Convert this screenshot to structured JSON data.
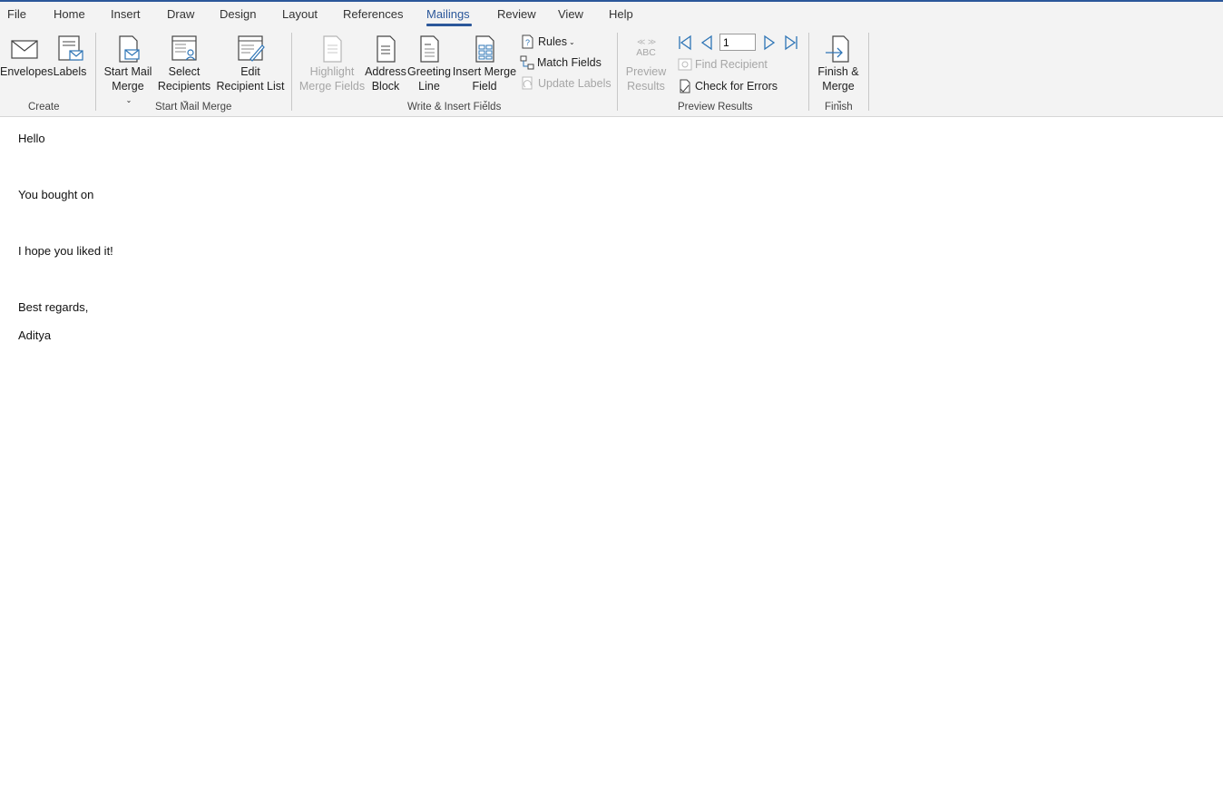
{
  "tabs": [
    "File",
    "Home",
    "Insert",
    "Draw",
    "Design",
    "Layout",
    "References",
    "Mailings",
    "Review",
    "View",
    "Help"
  ],
  "active_tab": "Mailings",
  "groups": {
    "create": {
      "label": "Create",
      "envelopes": "Envelopes",
      "labels": "Labels"
    },
    "start": {
      "label": "Start Mail Merge",
      "start_mail_merge": [
        "Start Mail",
        "Merge"
      ],
      "select_recipients": [
        "Select",
        "Recipients"
      ],
      "edit_recipient_list": [
        "Edit",
        "Recipient List"
      ]
    },
    "write": {
      "label": "Write & Insert Fields",
      "highlight": [
        "Highlight",
        "Merge Fields"
      ],
      "address_block": [
        "Address",
        "Block"
      ],
      "greeting_line": [
        "Greeting",
        "Line"
      ],
      "insert_merge_field": [
        "Insert Merge",
        "Field"
      ],
      "rules": "Rules",
      "match_fields": "Match Fields",
      "update_labels": "Update Labels"
    },
    "preview": {
      "label": "Preview Results",
      "preview_results": [
        "Preview",
        "Results"
      ],
      "abc": "ABC",
      "record_value": "1",
      "find_recipient": "Find Recipient",
      "check_errors": "Check for Errors"
    },
    "finish": {
      "label": "Finish",
      "finish_merge": [
        "Finish &",
        "Merge"
      ]
    }
  },
  "document": {
    "lines": [
      "Hello",
      "You bought on",
      "I hope you liked it!",
      "Best regards,",
      "Aditya"
    ]
  },
  "colors": {
    "accent": "#2b579a",
    "icon_blue": "#2e75b6",
    "ribbon_bg": "#f3f3f3"
  }
}
